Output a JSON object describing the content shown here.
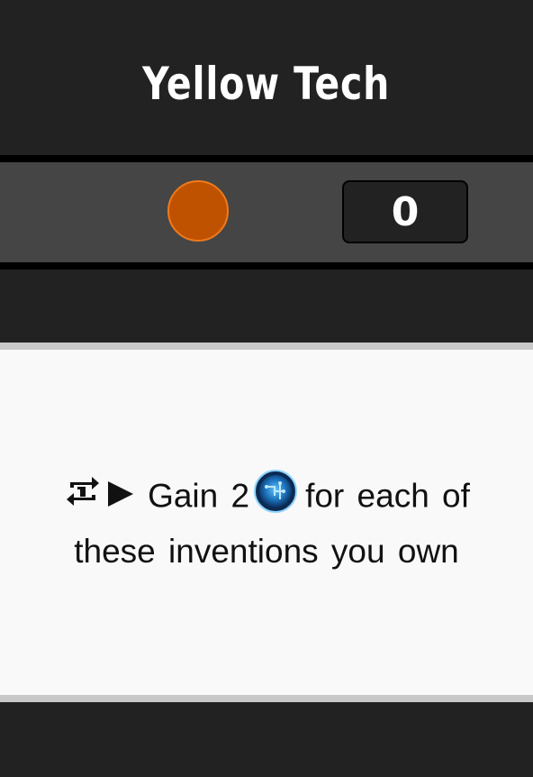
{
  "header": {
    "title": "Yellow Tech"
  },
  "counter": {
    "value": "0",
    "dot_color": "#bf5200"
  },
  "card": {
    "repeat_icon": "repeat-once-icon",
    "arrow_icon": "play-triangle-icon",
    "gain_text": "Gain 2",
    "resource_icon": "tech-token-icon",
    "text_after": "for each of these inventions you own"
  }
}
